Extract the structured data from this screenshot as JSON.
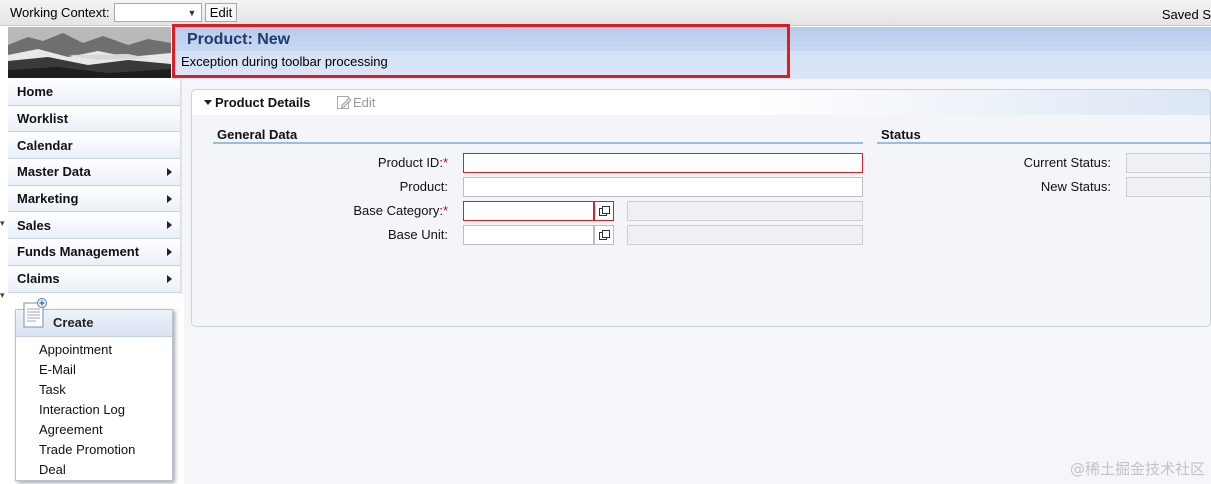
{
  "topbar": {
    "working_context_label": "Working Context:",
    "working_context_value": "",
    "edit_label": "Edit",
    "saved_text": "Saved S"
  },
  "header": {
    "title": "Product: New",
    "message": "Exception during toolbar processing"
  },
  "nav": {
    "items": [
      {
        "label": "Home",
        "has_submenu": false
      },
      {
        "label": "Worklist",
        "has_submenu": false
      },
      {
        "label": "Calendar",
        "has_submenu": false
      },
      {
        "label": "Master Data",
        "has_submenu": true
      },
      {
        "label": "Marketing",
        "has_submenu": true
      },
      {
        "label": "Sales",
        "has_submenu": true
      },
      {
        "label": "Funds Management",
        "has_submenu": true
      },
      {
        "label": "Claims",
        "has_submenu": true
      }
    ]
  },
  "create": {
    "title": "Create",
    "items": [
      "Appointment",
      "E-Mail",
      "Task",
      "Interaction Log",
      "Agreement",
      "Trade Promotion",
      "Deal"
    ]
  },
  "panel": {
    "title": "Product Details",
    "edit_label": "Edit",
    "general": {
      "title": "General Data",
      "fields": {
        "product_id": {
          "label": "Product ID:",
          "required": "*",
          "value": ""
        },
        "product": {
          "label": "Product:",
          "value": ""
        },
        "base_category": {
          "label": "Base Category:",
          "required": "*",
          "value": "",
          "description": ""
        },
        "base_unit": {
          "label": "Base Unit:",
          "value": "",
          "description": ""
        }
      }
    },
    "status": {
      "title": "Status",
      "current_status_label": "Current Status:",
      "current_status_value": "",
      "new_status_label": "New Status:",
      "new_status_value": ""
    }
  },
  "watermark": "@稀土掘金技术社区",
  "colors": {
    "header_title": "#1d3b6b",
    "highlight_border": "#e01b24",
    "error_border": "#d2222d",
    "required_marker": "#d40000",
    "section_line": "#9ebbe0"
  }
}
